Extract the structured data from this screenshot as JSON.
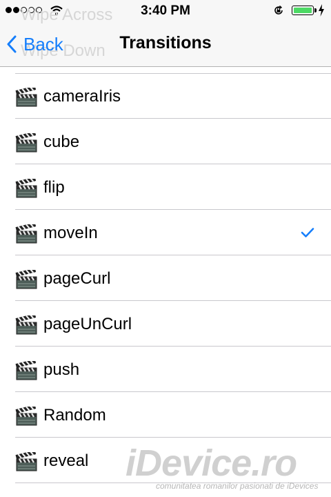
{
  "status_bar": {
    "time": "3:40 PM",
    "signal_bars_filled": 2,
    "signal_bars_total": 5,
    "battery_level": 1.0,
    "battery_color": "#4cd964"
  },
  "nav": {
    "background_titles": [
      "Wipe Across",
      "Wipe Down"
    ],
    "back_label": "Back",
    "title": "Transitions",
    "accent_color": "#157efb"
  },
  "transitions": [
    {
      "label": "cameraIris",
      "icon": "clapperboard-icon",
      "selected": false
    },
    {
      "label": "cube",
      "icon": "clapperboard-icon",
      "selected": false
    },
    {
      "label": "flip",
      "icon": "clapperboard-icon",
      "selected": false
    },
    {
      "label": "moveIn",
      "icon": "clapperboard-icon",
      "selected": true
    },
    {
      "label": "pageCurl",
      "icon": "clapperboard-icon",
      "selected": false
    },
    {
      "label": "pageUnCurl",
      "icon": "clapperboard-icon",
      "selected": false
    },
    {
      "label": "push",
      "icon": "clapperboard-icon",
      "selected": false
    },
    {
      "label": "Random",
      "icon": "clapperboard-icon",
      "selected": false
    },
    {
      "label": "reveal",
      "icon": "clapperboard-icon",
      "selected": false
    }
  ],
  "watermark": {
    "brand": "iDevice.ro",
    "tagline": "comunitatea romanilor pasionati de iDevices"
  }
}
